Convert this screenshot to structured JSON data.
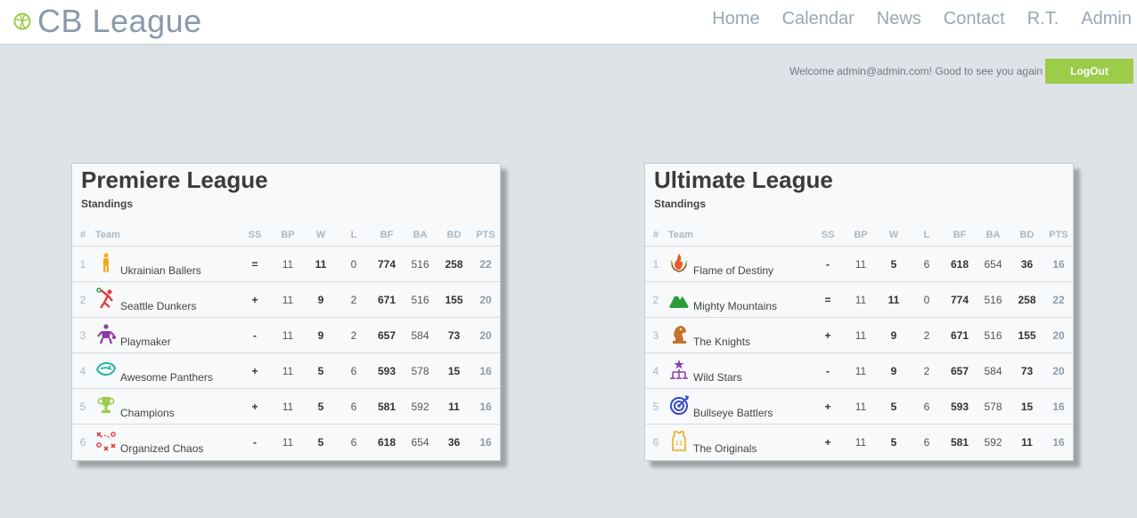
{
  "brand": {
    "name": "CB League",
    "icon": "basketball-icon",
    "accent": "#9ccc4a"
  },
  "nav": [
    "Home",
    "Calendar",
    "News",
    "Contact",
    "R.T.",
    "Admin"
  ],
  "session": {
    "welcome": "Welcome admin@admin.com! Good to see you again",
    "logout_label": "LogOut"
  },
  "columns": [
    "#",
    "Team",
    "SS",
    "BP",
    "W",
    "L",
    "BF",
    "BA",
    "BD",
    "PTS"
  ],
  "leagues": [
    {
      "title": "Premiere League",
      "subtitle": "Standings",
      "rows": [
        {
          "rank": "1",
          "team": "Ukrainian Ballers",
          "icon": "player-icon",
          "ss": "=",
          "bp": "11",
          "w": "11",
          "l": "0",
          "bf": "774",
          "ba": "516",
          "bd": "258",
          "pts": "22"
        },
        {
          "rank": "2",
          "team": "Seattle Dunkers",
          "icon": "dunk-icon",
          "ss": "+",
          "bp": "11",
          "w": "9",
          "l": "2",
          "bf": "671",
          "ba": "516",
          "bd": "155",
          "pts": "20"
        },
        {
          "rank": "3",
          "team": "Playmaker",
          "icon": "playmaker-icon",
          "ss": "-",
          "bp": "11",
          "w": "9",
          "l": "2",
          "bf": "657",
          "ba": "584",
          "bd": "73",
          "pts": "20"
        },
        {
          "rank": "4",
          "team": "Awesome Panthers",
          "icon": "panther-icon",
          "ss": "+",
          "bp": "11",
          "w": "5",
          "l": "6",
          "bf": "593",
          "ba": "578",
          "bd": "15",
          "pts": "16"
        },
        {
          "rank": "5",
          "team": "Champions",
          "icon": "trophy-icon",
          "ss": "+",
          "bp": "11",
          "w": "5",
          "l": "6",
          "bf": "581",
          "ba": "592",
          "bd": "11",
          "pts": "16"
        },
        {
          "rank": "6",
          "team": "Organized Chaos",
          "icon": "tactics-icon",
          "ss": "-",
          "bp": "11",
          "w": "5",
          "l": "6",
          "bf": "618",
          "ba": "654",
          "bd": "36",
          "pts": "16"
        }
      ]
    },
    {
      "title": "Ultimate League",
      "subtitle": "Standings",
      "rows": [
        {
          "rank": "1",
          "team": "Flame of Destiny",
          "icon": "flame-icon",
          "ss": "-",
          "bp": "11",
          "w": "5",
          "l": "6",
          "bf": "618",
          "ba": "654",
          "bd": "36",
          "pts": "16"
        },
        {
          "rank": "2",
          "team": "Mighty Mountains",
          "icon": "mountain-icon",
          "ss": "=",
          "bp": "11",
          "w": "11",
          "l": "0",
          "bf": "774",
          "ba": "516",
          "bd": "258",
          "pts": "22"
        },
        {
          "rank": "3",
          "team": "The Knights",
          "icon": "knight-icon",
          "ss": "+",
          "bp": "11",
          "w": "9",
          "l": "2",
          "bf": "671",
          "ba": "516",
          "bd": "155",
          "pts": "20"
        },
        {
          "rank": "4",
          "team": "Wild Stars",
          "icon": "star-icon",
          "ss": "-",
          "bp": "11",
          "w": "9",
          "l": "2",
          "bf": "657",
          "ba": "584",
          "bd": "73",
          "pts": "20"
        },
        {
          "rank": "5",
          "team": "Bullseye Battlers",
          "icon": "bullseye-icon",
          "ss": "+",
          "bp": "11",
          "w": "5",
          "l": "6",
          "bf": "593",
          "ba": "578",
          "bd": "15",
          "pts": "16"
        },
        {
          "rank": "6",
          "team": "The Originals",
          "icon": "jersey-icon",
          "ss": "+",
          "bp": "11",
          "w": "5",
          "l": "6",
          "bf": "581",
          "ba": "592",
          "bd": "11",
          "pts": "16"
        }
      ]
    }
  ]
}
